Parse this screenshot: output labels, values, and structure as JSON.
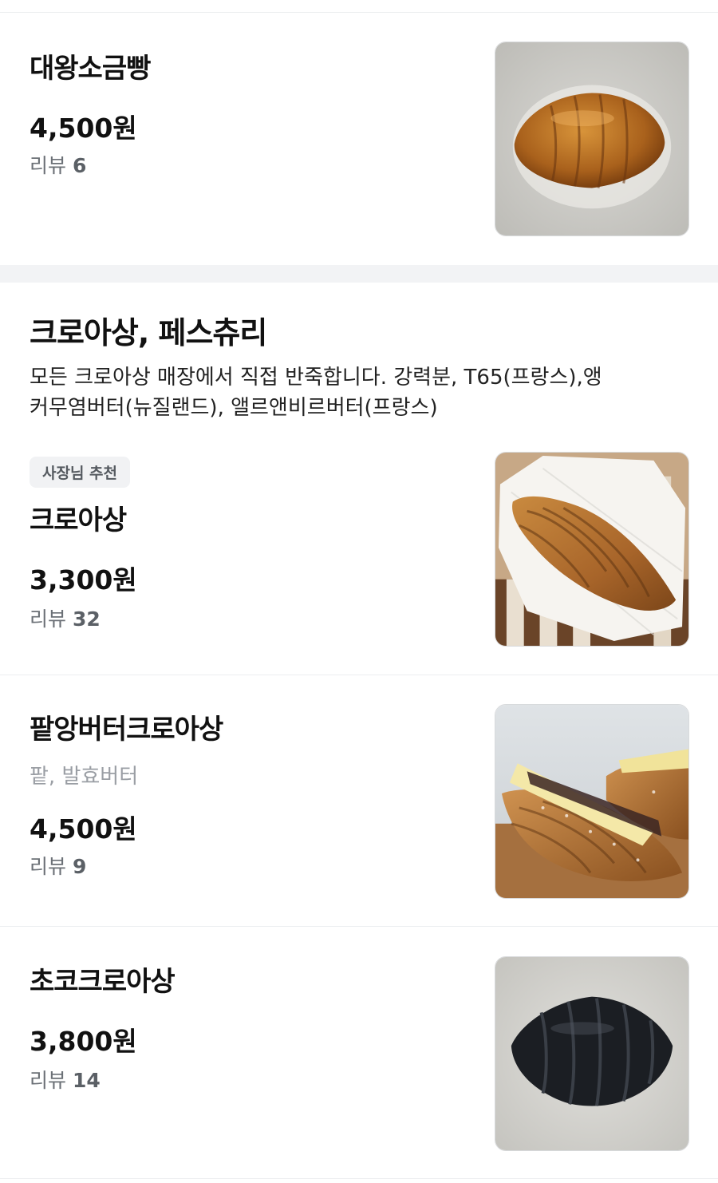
{
  "items_top": [
    {
      "name": "대왕소금빵",
      "price": "4,500원",
      "review_label": "리뷰",
      "review_count": "6"
    }
  ],
  "category": {
    "title": "크로아상, 페스츄리",
    "description_line1": "모든 크로아상 매장에서 직접 반죽합니다.  강력분, T65(프랑스),앵",
    "description_line2": "커무염버터(뉴질랜드), 앨르앤비르버터(프랑스)"
  },
  "items": [
    {
      "badge": "사장님 추천",
      "name": "크로아상",
      "price": "3,300원",
      "review_label": "리뷰",
      "review_count": "32"
    },
    {
      "name": "팥앙버터크로아상",
      "description": "팥, 발효버터",
      "price": "4,500원",
      "review_label": "리뷰",
      "review_count": "9"
    },
    {
      "name": "초코크로아상",
      "price": "3,800원",
      "review_label": "리뷰",
      "review_count": "14"
    }
  ]
}
